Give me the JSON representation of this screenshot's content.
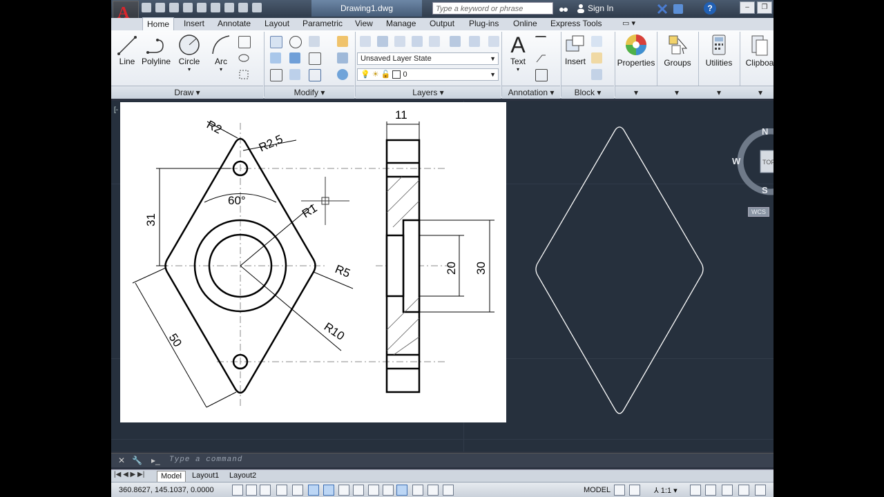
{
  "app": {
    "document_title": "Drawing1.dwg",
    "search_placeholder": "Type a keyword or phrase",
    "sign_in": "Sign In",
    "help": "?"
  },
  "tabs": [
    "Home",
    "Insert",
    "Annotate",
    "Layout",
    "Parametric",
    "View",
    "Manage",
    "Output",
    "Plug-ins",
    "Online",
    "Express Tools"
  ],
  "ribbon": {
    "draw": {
      "tools": [
        "Line",
        "Polyline",
        "Circle",
        "Arc"
      ],
      "panel": "Draw"
    },
    "modify": {
      "panel": "Modify"
    },
    "layers": {
      "layer_state": "Unsaved Layer State",
      "current_layer": "0",
      "panel": "Layers"
    },
    "annotation": {
      "text": "Text",
      "panel": "Annotation"
    },
    "block": {
      "insert": "Insert",
      "panel": "Block"
    },
    "big_tools": [
      "Properties",
      "Groups",
      "Utilities",
      "Clipboa"
    ]
  },
  "drawing": {
    "dimensions": {
      "r2": "R2",
      "r25": "R2,5",
      "angle": "60°",
      "r1": "R1",
      "r5": "R5",
      "r10": "R10",
      "d31": "31",
      "d50": "50",
      "d11": "11",
      "d20": "20",
      "d30": "30"
    }
  },
  "viewcube": {
    "n": "N",
    "w": "W",
    "s": "S",
    "top": "TOP",
    "wcs": "WCS"
  },
  "command": {
    "placeholder": "Type a command"
  },
  "layouts": [
    "Model",
    "Layout1",
    "Layout2"
  ],
  "status": {
    "coordinates": "360.8627, 145.1037, 0.0000",
    "model": "MODEL",
    "scale": "1:1"
  },
  "colors": {
    "accent": "#d9262c",
    "canvas": "#26303d",
    "ribbon": "#e3e8ef",
    "wireframe": "#ffffff"
  }
}
